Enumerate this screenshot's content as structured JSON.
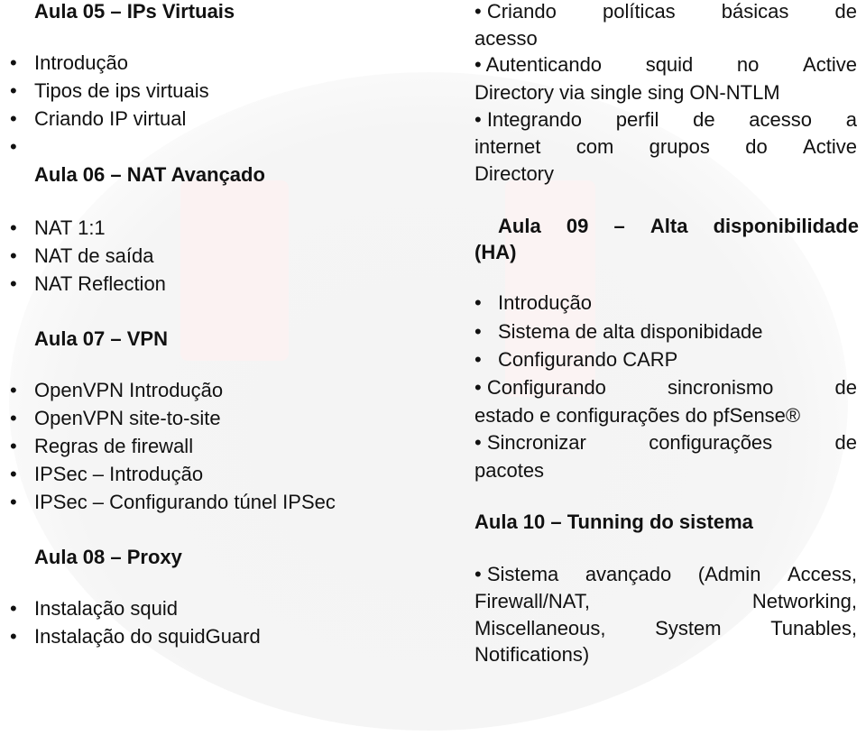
{
  "left_column": {
    "aula05": {
      "title": "Aula 05 – IPs Virtuais",
      "items": [
        "Introdução",
        "Tipos de ips virtuais",
        "Criando IP virtual",
        ""
      ]
    },
    "aula06": {
      "title": "Aula 06 – NAT Avançado",
      "items": [
        "NAT 1:1",
        "NAT de saída",
        "NAT Reflection"
      ]
    },
    "aula07": {
      "title": "Aula 07 – VPN",
      "items": [
        "OpenVPN Introdução",
        "OpenVPN site-to-site",
        "Regras de firewall",
        "IPSec – Introdução",
        "IPSec – Configurando túnel IPSec"
      ]
    },
    "aula08": {
      "title": "Aula 08 – Proxy",
      "items": [
        "Instalação squid",
        "Instalação do squidGuard"
      ]
    }
  },
  "right_column": {
    "aula08_cont": {
      "items": [
        {
          "line1": [
            "• Criando",
            "políticas",
            "básicas",
            "de"
          ],
          "line2": "acesso"
        },
        {
          "line1": [
            "• Autenticando",
            "squid",
            "no",
            "Active"
          ],
          "line2": "Directory via single sing ON-NTLM"
        },
        {
          "line1": [
            "• Integrando",
            "perfil",
            "de",
            "acesso",
            "a"
          ],
          "line2_words": [
            "internet",
            "com",
            "grupos",
            "do",
            "Active"
          ],
          "line3": "Directory"
        }
      ]
    },
    "aula09": {
      "title_words": [
        "Aula",
        "09",
        "–",
        "Alta",
        "disponibilidade"
      ],
      "title_line2": "(HA)",
      "items": [
        "Introdução",
        "Sistema de alta disponibidade",
        "Configurando CARP"
      ],
      "item_sync": {
        "line1": [
          "• Configurando",
          "sincronismo",
          "de"
        ],
        "line2": "estado e configurações do pfSense®"
      },
      "item_pkg": {
        "line1": [
          "• Sincronizar",
          "configurações",
          "de"
        ],
        "line2": "pacotes"
      }
    },
    "aula10": {
      "title": "Aula 10 – Tunning do sistema",
      "item": {
        "line1": [
          "• Sistema",
          "avançado",
          "(Admin",
          "Access,"
        ],
        "line2": [
          "Firewall/NAT,",
          "Networking,"
        ],
        "line3": [
          "Miscellaneous,",
          "System",
          "Tunables,"
        ],
        "line4": "Notifications)"
      }
    }
  }
}
